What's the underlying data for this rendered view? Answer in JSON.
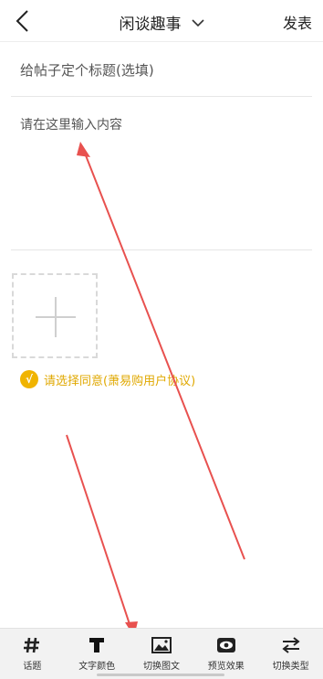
{
  "header": {
    "title": "闲谈趣事",
    "publish_label": "发表"
  },
  "form": {
    "title_placeholder": "给帖子定个标题(选填)",
    "content_placeholder": "请在这里输入内容"
  },
  "agreement": {
    "text": "请选择同意(萧易购用户协议)",
    "check_mark": "√",
    "accent_color": "#f0b400"
  },
  "toolbar": {
    "items": [
      {
        "label": "话题",
        "icon": "hash-icon"
      },
      {
        "label": "文字颜色",
        "icon": "text-color-icon"
      },
      {
        "label": "切换图文",
        "icon": "image-icon"
      },
      {
        "label": "预览效果",
        "icon": "eye-icon"
      },
      {
        "label": "切换类型",
        "icon": "switch-arrows-icon"
      }
    ]
  }
}
